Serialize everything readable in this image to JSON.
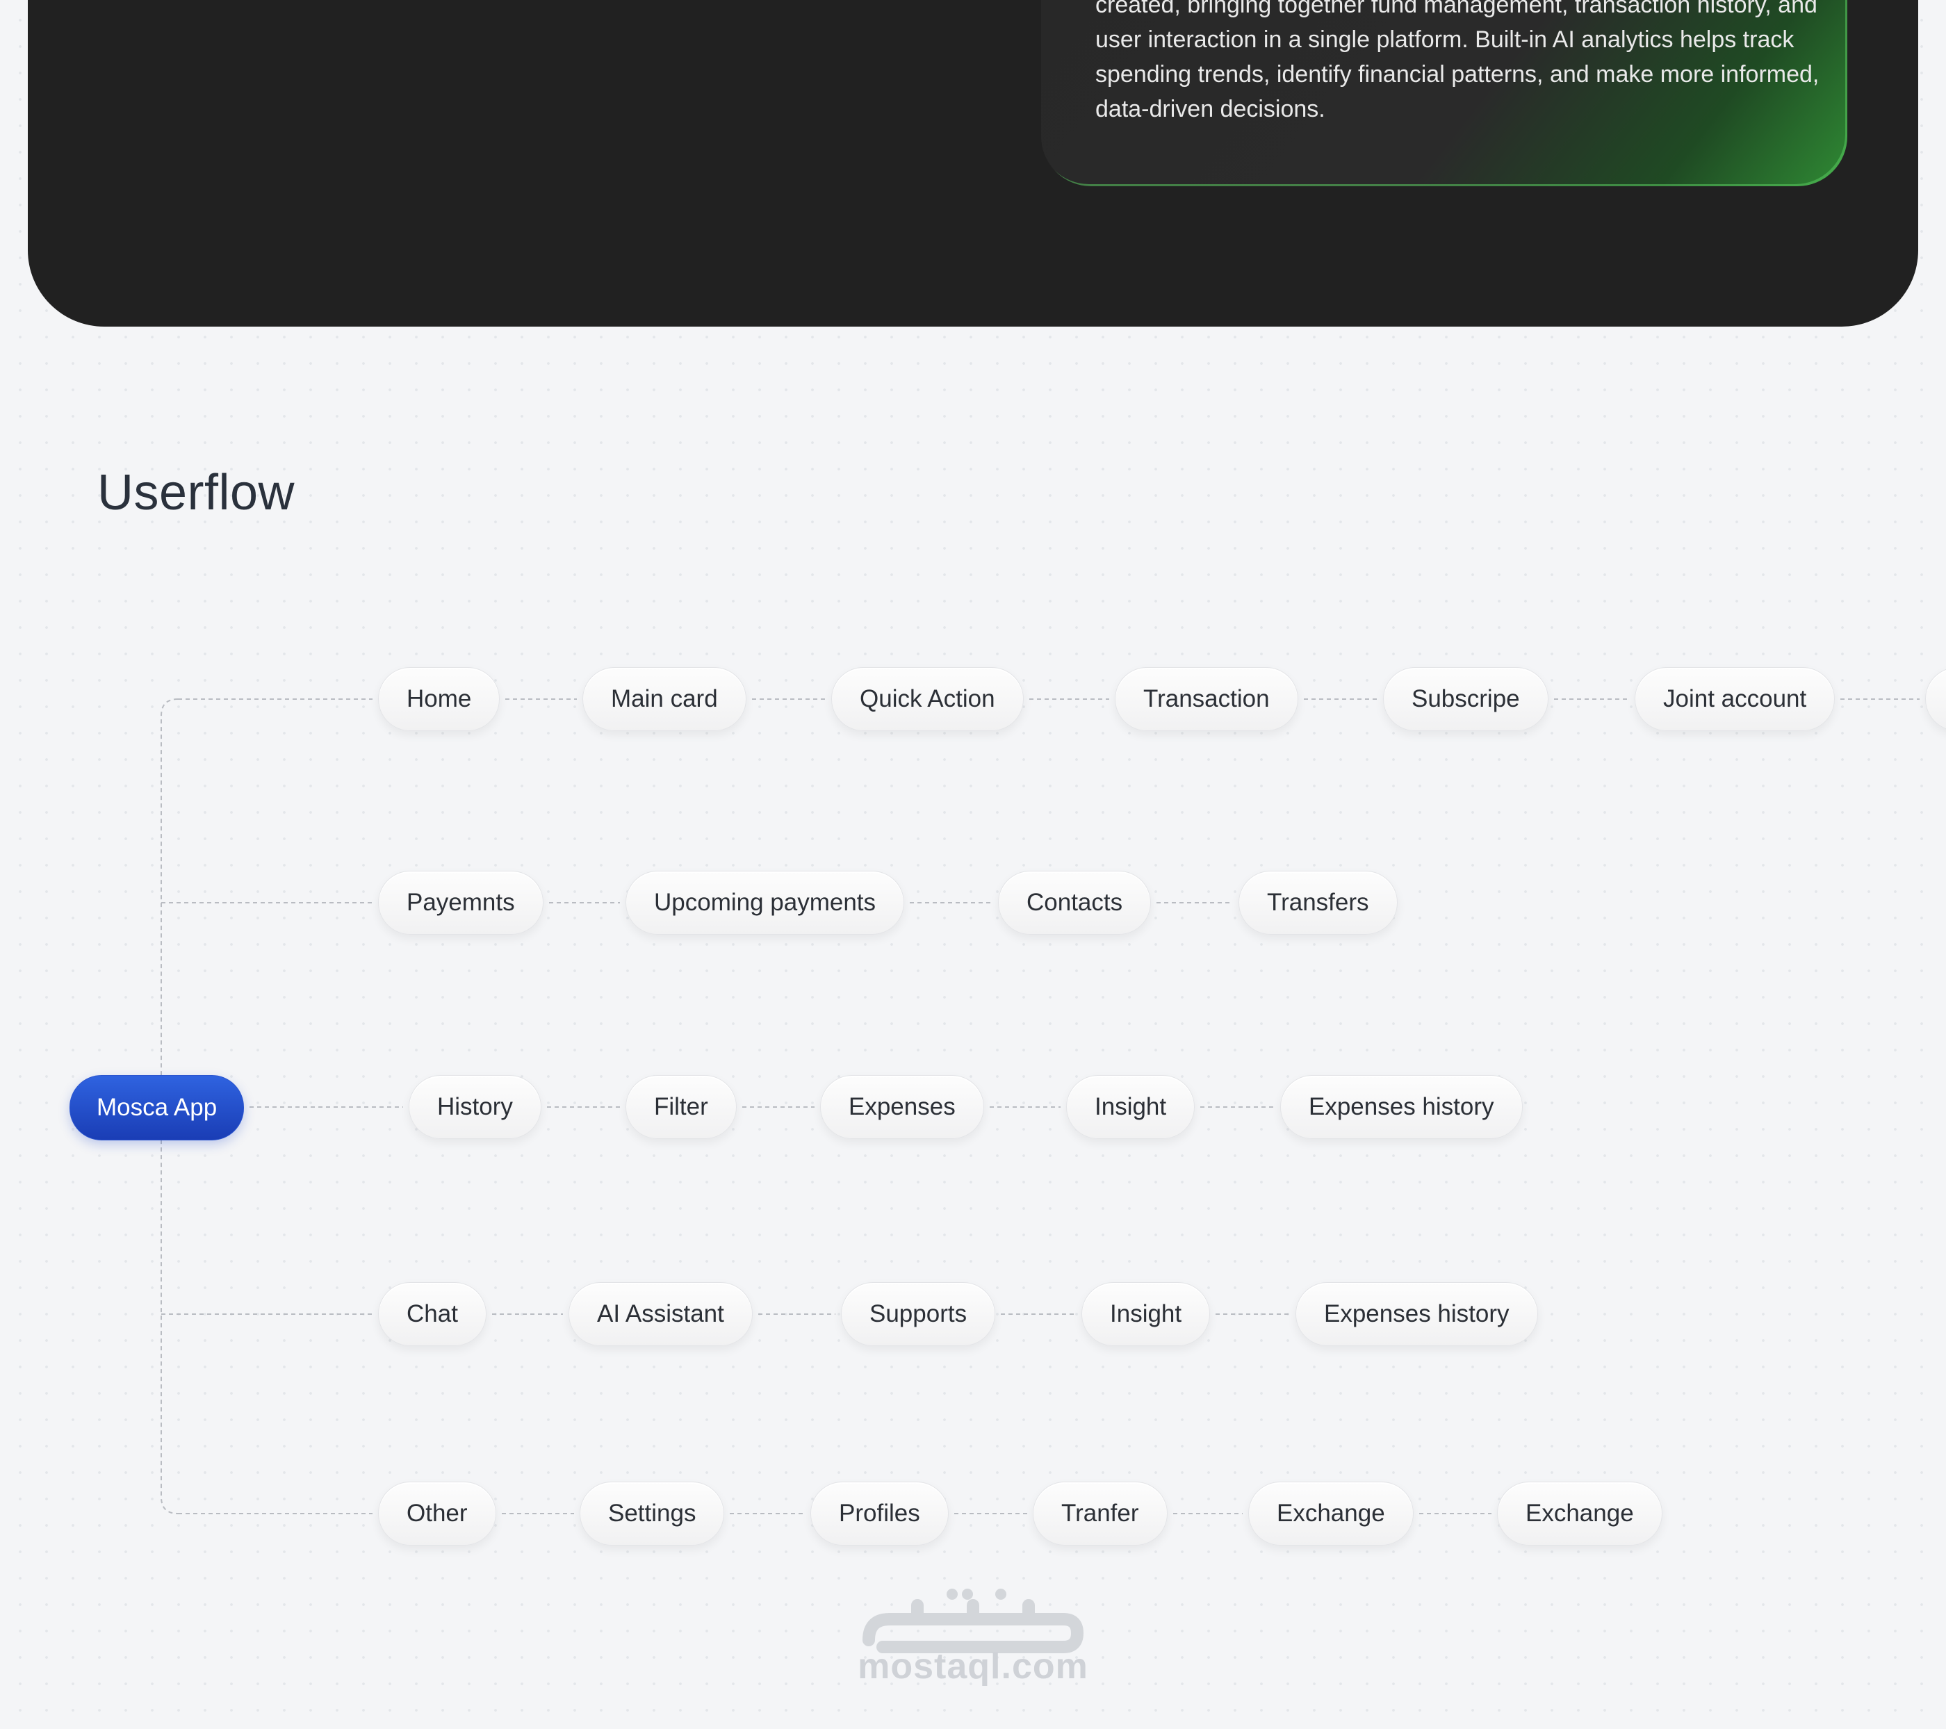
{
  "hero": {
    "description": "created, bringing together fund management, transaction history, and user interaction in a single platform. Built-in AI analytics helps track spending trends, identify financial patterns, and make more informed, data-driven decisions."
  },
  "userflow": {
    "title": "Userflow",
    "root": "Mosca App",
    "rows": [
      [
        "Home",
        "Main card",
        "Quick Action",
        "Transaction",
        "Subscripe",
        "Joint account",
        ""
      ],
      [
        "Payemnts",
        "Upcoming payments",
        "Contacts",
        "Transfers"
      ],
      [
        "History",
        "Filter",
        "Expenses",
        "Insight",
        "Expenses history"
      ],
      [
        "Chat",
        "AI Assistant",
        "Supports",
        "Insight",
        "Expenses history"
      ],
      [
        "Other",
        "Settings",
        "Profiles",
        "Tranfer",
        "Exchange",
        "Exchange"
      ]
    ]
  },
  "watermark": {
    "logo_text": "mostaql.com"
  }
}
